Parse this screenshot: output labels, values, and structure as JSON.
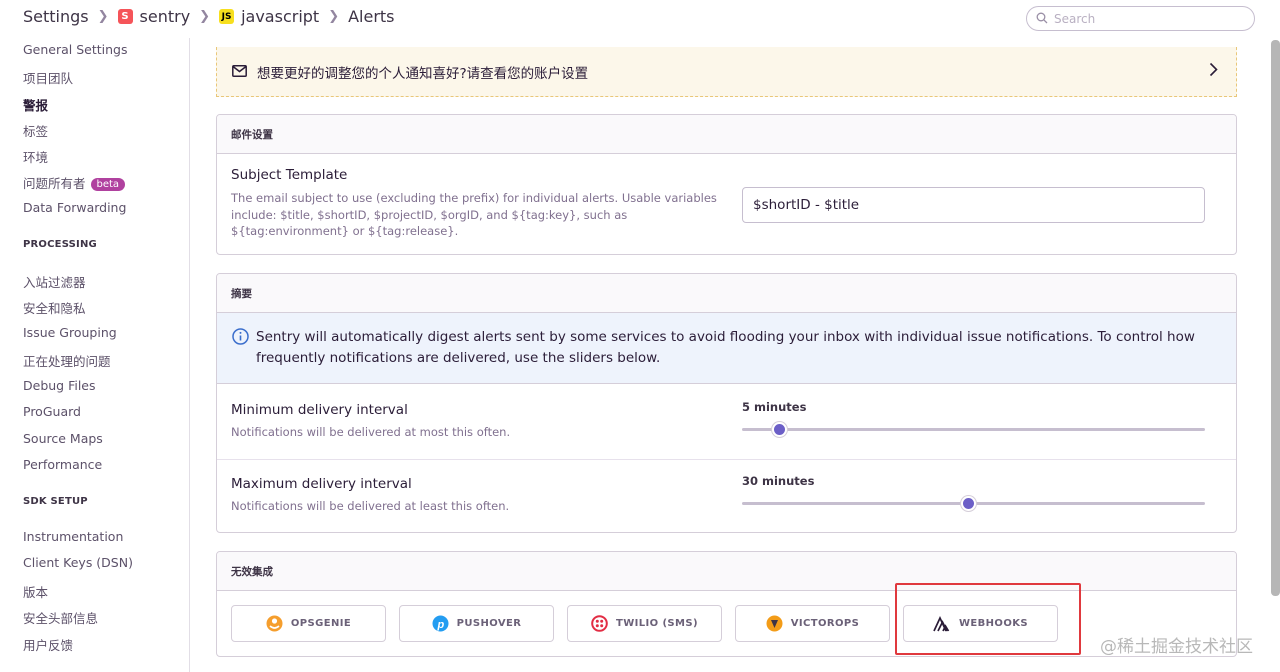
{
  "breadcrumb": {
    "settings": "Settings",
    "org": "sentry",
    "org_badge": "S",
    "project": "javascript",
    "project_badge": "JS",
    "page": "Alerts"
  },
  "search": {
    "placeholder": "Search"
  },
  "sidebar": {
    "items_top": [
      "General Settings",
      "项目团队",
      "警报",
      "标签",
      "环境",
      "问题所有者",
      "Data Forwarding"
    ],
    "beta_label": "beta",
    "processing_heading": "PROCESSING",
    "processing": [
      "入站过滤器",
      "安全和隐私",
      "Issue Grouping",
      "正在处理的问题",
      "Debug Files",
      "ProGuard",
      "Source Maps",
      "Performance"
    ],
    "sdk_heading": "SDK SETUP",
    "sdk": [
      "Instrumentation",
      "Client Keys (DSN)",
      "版本",
      "安全头部信息",
      "用户反馈"
    ]
  },
  "banner": {
    "text": "想要更好的调整您的个人通知喜好?请查看您的账户设置"
  },
  "email_panel": {
    "heading": "邮件设置",
    "label": "Subject Template",
    "help": "The email subject to use (excluding the prefix) for individual alerts. Usable variables include: $title, $shortID, $projectID, $orgID, and ${tag:key}, such as ${tag:environment} or ${tag:release}.",
    "value": "$shortID - $title"
  },
  "digest_panel": {
    "heading": "摘要",
    "info": "Sentry will automatically digest alerts sent by some services to avoid flooding your inbox with individual issue notifications. To control how frequently notifications are delivered, use the sliders below.",
    "min_label": "Minimum delivery interval",
    "min_help": "Notifications will be delivered at most this often.",
    "min_value": "5 minutes",
    "min_position": 0.08,
    "max_label": "Maximum delivery interval",
    "max_help": "Notifications will be delivered at least this often.",
    "max_value": "30 minutes",
    "max_position": 0.49
  },
  "integrations_panel": {
    "heading": "无效集成",
    "items": [
      "OPSGENIE",
      "PUSHOVER",
      "TWILIO (SMS)",
      "VICTOROPS",
      "WEBHOOKS"
    ]
  },
  "watermark": "@稀土掘金技术社区",
  "colors": {
    "accent": "#6c5fc7",
    "highlight": "#e0393e",
    "banner_bg": "#fcf7ea"
  }
}
